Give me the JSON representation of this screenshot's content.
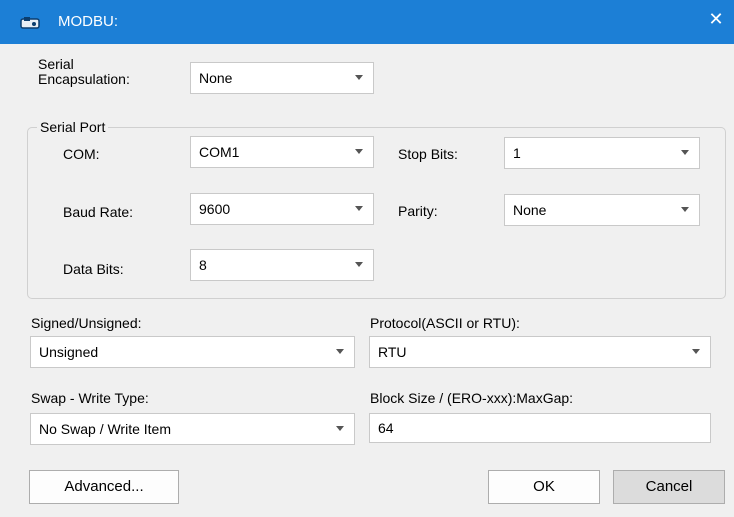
{
  "window": {
    "title": "MODBU:",
    "close_glyph": "✕",
    "icon": "app-icon"
  },
  "serial_encapsulation": {
    "label": "Serial Encapsulation:",
    "value": "None"
  },
  "serial_port": {
    "group_label": "Serial Port",
    "com": {
      "label": "COM:",
      "value": "COM1"
    },
    "stop_bits": {
      "label": "Stop Bits:",
      "value": "1"
    },
    "baud_rate": {
      "label": "Baud Rate:",
      "value": "9600"
    },
    "parity": {
      "label": "Parity:",
      "value": "None"
    },
    "data_bits": {
      "label": "Data Bits:",
      "value": "8"
    }
  },
  "signed_unsigned": {
    "label": "Signed/Unsigned:",
    "value": "Unsigned"
  },
  "protocol": {
    "label": "Protocol(ASCII or RTU):",
    "value": "RTU"
  },
  "swap_write_type": {
    "label": "Swap - Write Type:",
    "value": "No Swap / Write Item"
  },
  "block_size": {
    "label": "Block Size / (ERO-xxx):MaxGap:",
    "value": "64"
  },
  "buttons": {
    "advanced": "Advanced...",
    "ok": "OK",
    "cancel": "Cancel"
  }
}
